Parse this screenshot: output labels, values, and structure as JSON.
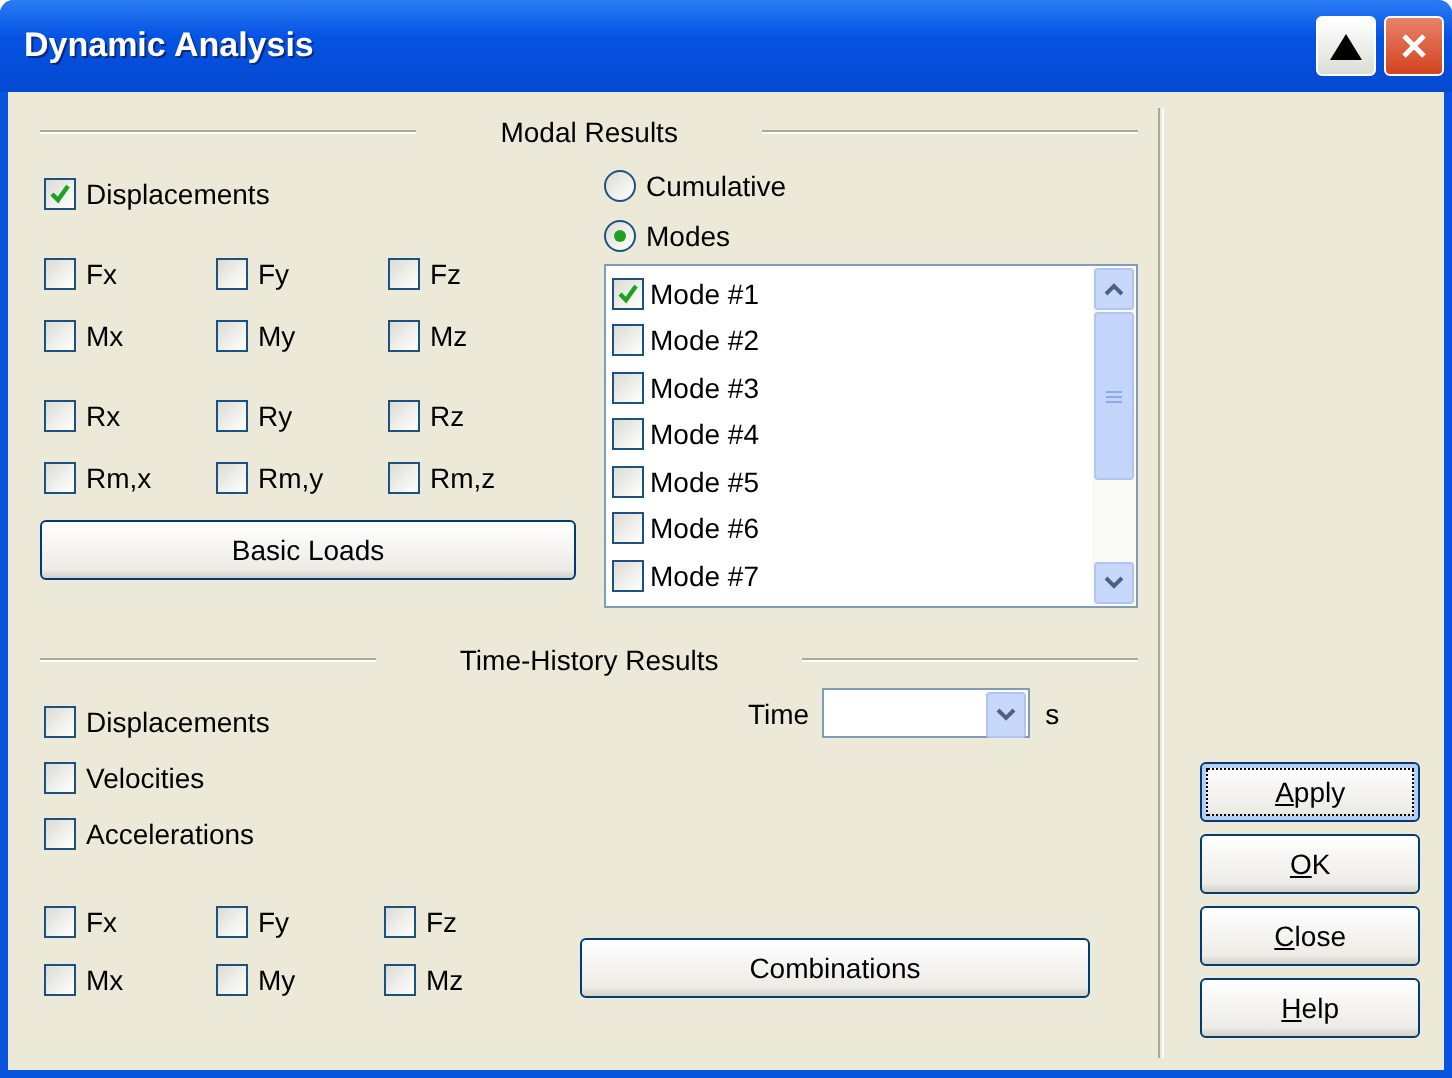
{
  "window": {
    "title": "Dynamic Analysis"
  },
  "modal_results": {
    "title": "Modal Results",
    "displacements": {
      "label": "Displacements",
      "checked": true
    },
    "component_groups": [
      [
        {
          "label": "Fx",
          "checked": false
        },
        {
          "label": "Fy",
          "checked": false
        },
        {
          "label": "Fz",
          "checked": false
        },
        {
          "label": "Mx",
          "checked": false
        },
        {
          "label": "My",
          "checked": false
        },
        {
          "label": "Mz",
          "checked": false
        }
      ],
      [
        {
          "label": "Rx",
          "checked": false
        },
        {
          "label": "Ry",
          "checked": false
        },
        {
          "label": "Rz",
          "checked": false
        },
        {
          "label": "Rm,x",
          "checked": false
        },
        {
          "label": "Rm,y",
          "checked": false
        },
        {
          "label": "Rm,z",
          "checked": false
        }
      ]
    ],
    "basic_loads_button": "Basic Loads",
    "mode_options": [
      {
        "label": "Cumulative",
        "selected": false
      },
      {
        "label": "Modes",
        "selected": true
      }
    ],
    "modes": [
      {
        "label": "Mode #1",
        "checked": true
      },
      {
        "label": "Mode #2",
        "checked": false
      },
      {
        "label": "Mode #3",
        "checked": false
      },
      {
        "label": "Mode #4",
        "checked": false
      },
      {
        "label": "Mode #5",
        "checked": false
      },
      {
        "label": "Mode #6",
        "checked": false
      },
      {
        "label": "Mode #7",
        "checked": false
      }
    ]
  },
  "time_history_results": {
    "title": "Time-History Results",
    "options": [
      {
        "label": "Displacements",
        "checked": false
      },
      {
        "label": "Velocities",
        "checked": false
      },
      {
        "label": "Accelerations",
        "checked": false
      }
    ],
    "components": [
      {
        "label": "Fx",
        "checked": false
      },
      {
        "label": "Fy",
        "checked": false
      },
      {
        "label": "Fz",
        "checked": false
      },
      {
        "label": "Mx",
        "checked": false
      },
      {
        "label": "My",
        "checked": false
      },
      {
        "label": "Mz",
        "checked": false
      }
    ],
    "time": {
      "label": "Time",
      "unit": "s"
    },
    "combinations_button": "Combinations"
  },
  "buttons": [
    {
      "label": "Apply",
      "focused": true
    },
    {
      "label": "OK",
      "focused": false
    },
    {
      "label": "Close",
      "focused": false
    },
    {
      "label": "Help",
      "focused": false
    }
  ]
}
